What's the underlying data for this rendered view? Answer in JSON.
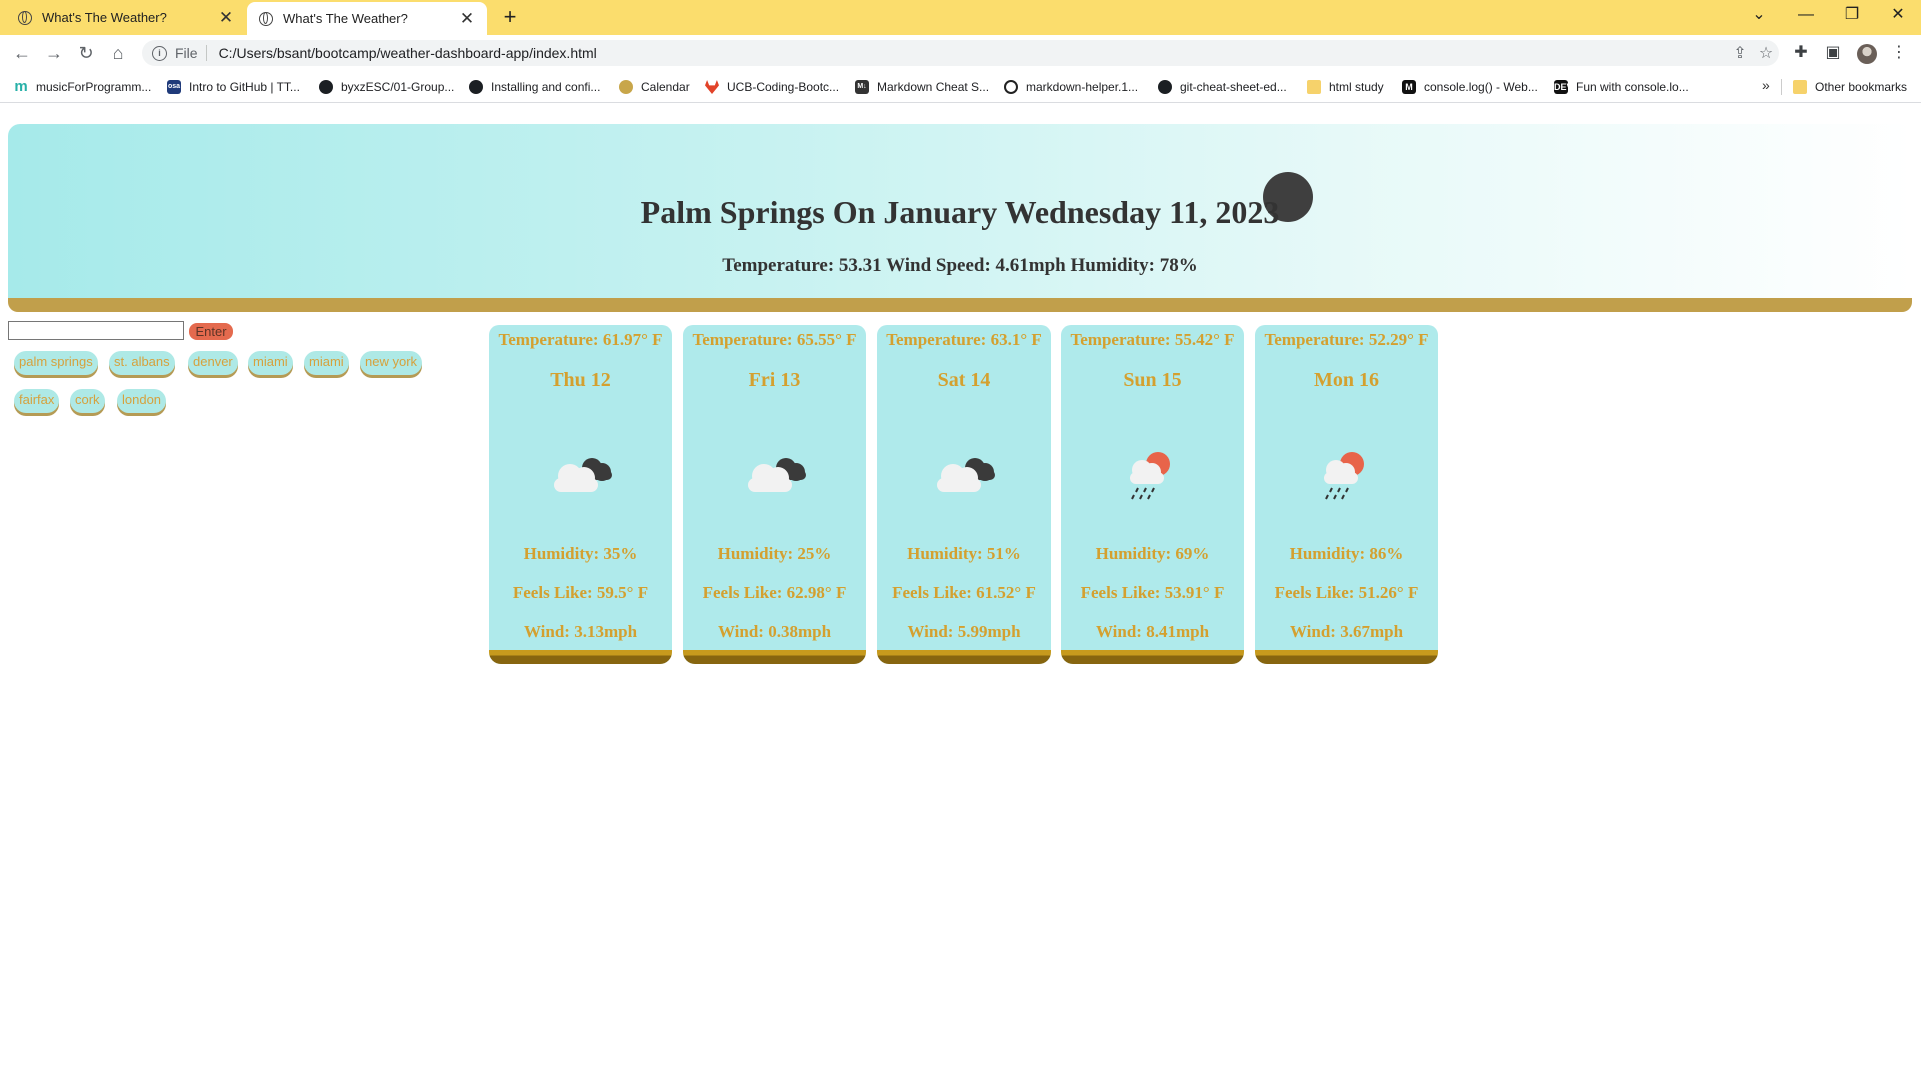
{
  "browser": {
    "tabs": [
      {
        "title": "What's The Weather?",
        "active": false
      },
      {
        "title": "What's The Weather?",
        "active": true
      }
    ],
    "new_tab": "+",
    "window_controls": {
      "dropdown": "⌄",
      "minimize": "—",
      "restore": "❐",
      "close": "✕"
    },
    "nav": {
      "back": "←",
      "forward": "→",
      "reload": "↻",
      "home": "⌂"
    },
    "address": {
      "scheme": "File",
      "url": "C:/Users/bsant/bootcamp/weather-dashboard-app/index.html"
    },
    "bookmarks": [
      {
        "label": "musicForProgramm...",
        "icon": "m"
      },
      {
        "label": "Intro to GitHub | TT...",
        "icon": "osa"
      },
      {
        "label": "byxzESC/01-Group...",
        "icon": "gh"
      },
      {
        "label": "Installing and confi...",
        "icon": "gh"
      },
      {
        "label": "Calendar",
        "icon": "cal"
      },
      {
        "label": "UCB-Coding-Bootc...",
        "icon": "gl"
      },
      {
        "label": "Markdown Cheat S...",
        "icon": "md"
      },
      {
        "label": "markdown-helper.1...",
        "icon": "ring"
      },
      {
        "label": "git-cheat-sheet-ed...",
        "icon": "gh"
      },
      {
        "label": "html study",
        "icon": "folder"
      },
      {
        "label": "console.log() - Web...",
        "icon": "dark"
      },
      {
        "label": "Fun with console.lo...",
        "icon": "dark"
      }
    ],
    "bookmarks_more": "»",
    "other_bookmarks": "Other bookmarks"
  },
  "hero": {
    "title": "Palm Springs On January Wednesday 11, 2023",
    "subtitle": "Temperature: 53.31 Wind Speed: 4.61mph Humidity: 78%"
  },
  "search": {
    "value": "",
    "button_label": "Enter"
  },
  "history": [
    "palm springs",
    "st. albans",
    "denver",
    "miami",
    "miami",
    "new york",
    "fairfax",
    "cork",
    "london"
  ],
  "forecast": [
    {
      "temp": "Temperature: 61.97° F",
      "day": "Thu 12",
      "icon": "cloudy-icon",
      "humidity": "Humidity: 35%",
      "feels": "Feels Like: 59.5° F",
      "wind": "Wind: 3.13mph"
    },
    {
      "temp": "Temperature: 65.55° F",
      "day": "Fri 13",
      "icon": "cloudy-icon",
      "humidity": "Humidity: 25%",
      "feels": "Feels Like: 62.98° F",
      "wind": "Wind: 0.38mph"
    },
    {
      "temp": "Temperature: 63.1° F",
      "day": "Sat 14",
      "icon": "cloudy-icon",
      "humidity": "Humidity: 51%",
      "feels": "Feels Like: 61.52° F",
      "wind": "Wind: 5.99mph"
    },
    {
      "temp": "Temperature: 55.42° F",
      "day": "Sun 15",
      "icon": "rain-sun-icon",
      "humidity": "Humidity: 69%",
      "feels": "Feels Like: 53.91° F",
      "wind": "Wind: 8.41mph"
    },
    {
      "temp": "Temperature: 52.29° F",
      "day": "Mon 16",
      "icon": "rain-sun-icon",
      "humidity": "Humidity: 86%",
      "feels": "Feels Like: 51.26° F",
      "wind": "Wind: 3.67mph"
    }
  ],
  "colors": {
    "hero": "#a6eaea",
    "card": "#afeaeb",
    "card_text": "#d4a02f",
    "accent": "#e46a4e",
    "tabstrip": "#fbdd6d"
  }
}
